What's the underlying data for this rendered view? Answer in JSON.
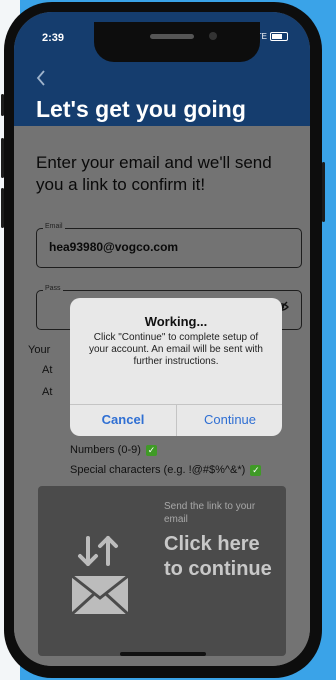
{
  "status": {
    "time": "2:39",
    "network": "LTE"
  },
  "header": {
    "back_icon": "chevron-left-icon",
    "title": "Let's get you going"
  },
  "intro": "Enter your email and we'll send you a link to confirm it!",
  "email_field": {
    "label": "Email",
    "value": "hea93980@vogco.com"
  },
  "password_field": {
    "label": "Pass"
  },
  "requirements": {
    "heading": "Your",
    "items": [
      "At",
      "At",
      "Numbers (0-9)",
      "Special characters (e.g. !@#$%^&*)"
    ]
  },
  "cta": {
    "subtitle": "Send the link to your email",
    "main": "Click here to continue"
  },
  "dialog": {
    "title": "Working...",
    "message": "Click \"Continue\" to complete setup of your account. An email will be sent with further instructions.",
    "cancel_label": "Cancel",
    "continue_label": "Continue"
  },
  "colors": {
    "background": "#3aa3e8",
    "header": "#153d6e",
    "dialog_button": "#2f6fd3",
    "check": "#3f9a26"
  }
}
